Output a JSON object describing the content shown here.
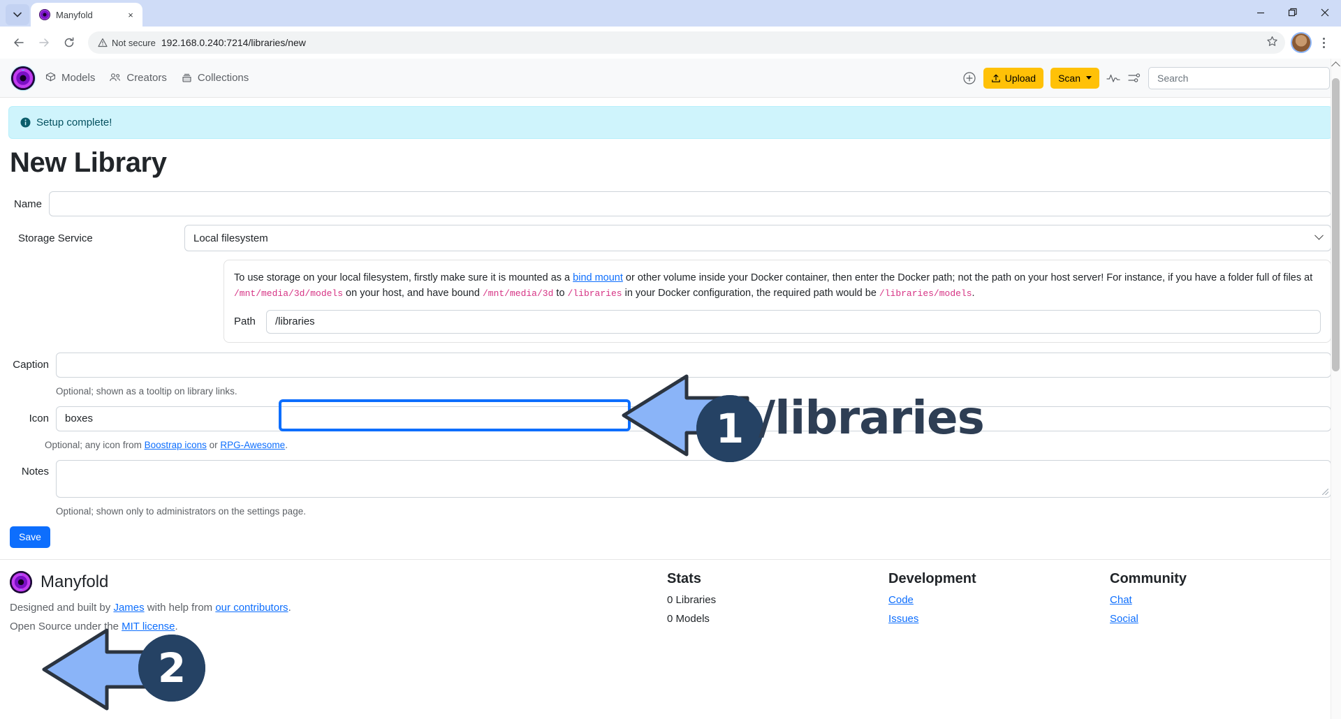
{
  "browser": {
    "tab": {
      "title": "Manyfold",
      "favicon": "manyfold-logo-icon",
      "close": "×"
    },
    "tab_list_icon": "chevron-down-icon",
    "window": {
      "minimize": "–",
      "maximize": "❐",
      "close": "✕"
    },
    "nav": {
      "back": "←",
      "forward": "→",
      "reload": "⟳"
    },
    "security_label": "Not secure",
    "url": "192.168.0.240:7214/libraries/new",
    "bookmark_icon": "star-icon",
    "profile_icon": "profile-avatar",
    "menu_icon": "kebab-menu-icon"
  },
  "sitenav": {
    "brand": "manyfold-logo",
    "links": [
      {
        "label": "Models",
        "icon": "cube-icon"
      },
      {
        "label": "Creators",
        "icon": "people-icon"
      },
      {
        "label": "Collections",
        "icon": "collection-icon"
      }
    ],
    "add_icon": "plus-circle-icon",
    "upload_label": "Upload",
    "upload_icon": "upload-icon",
    "scan_label": "Scan",
    "scan_caret": "caret-down-icon",
    "activity_icon": "activity-pulse-icon",
    "settings_icon": "sliders-icon",
    "search_placeholder": "Search"
  },
  "alert": {
    "icon": "info-circle-icon",
    "text": "Setup complete!"
  },
  "page": {
    "title": "New Library"
  },
  "form": {
    "name": {
      "label": "Name",
      "value": "",
      "placeholder": ""
    },
    "storage_service": {
      "label": "Storage Service",
      "value": "Local filesystem",
      "chevron": "chevron-down-icon"
    },
    "help": {
      "part1": "To use storage on your local filesystem, firstly make sure it is mounted as a ",
      "link1": "bind mount",
      "part2": " or other volume inside your Docker container, then enter the Docker path; not the path on your host server! For instance, if you have a folder full of files at ",
      "code1": "/mnt/media/3d/models",
      "part3": " on your host, and have bound ",
      "code2": "/mnt/media/3d",
      "part4": " to ",
      "code3": "/libraries",
      "part5": " in your Docker configuration, the required path would be ",
      "code4": "/libraries/models",
      "part6": "."
    },
    "path": {
      "label": "Path",
      "value": "/libraries"
    },
    "caption": {
      "label": "Caption",
      "value": "",
      "hint": "Optional; shown as a tooltip on library links."
    },
    "icon": {
      "label": "Icon",
      "value": "boxes",
      "hint_prefix": "Optional; any icon from ",
      "link1": "Boostrap icons",
      "hint_mid": " or ",
      "link2": "RPG-Awesome",
      "hint_suffix": "."
    },
    "notes": {
      "label": "Notes",
      "value": "",
      "hint": "Optional; shown only to administrators on the settings page."
    },
    "save_label": "Save"
  },
  "footer": {
    "brand_name": "Manyfold",
    "line1_prefix": "Designed and built by ",
    "line1_link1": "James",
    "line1_mid": " with help from ",
    "line1_link2": "our contributors",
    "line1_suffix": ".",
    "line2_prefix": "Open Source under the ",
    "line2_link": "MIT license",
    "line2_suffix": ".",
    "columns": [
      {
        "heading": "Stats",
        "items": [
          "0 Libraries",
          "0 Models"
        ],
        "links": false
      },
      {
        "heading": "Development",
        "items": [
          "Code",
          "Issues"
        ],
        "links": true
      },
      {
        "heading": "Community",
        "items": [
          "Chat",
          "Social"
        ],
        "links": true
      }
    ]
  },
  "annotations": {
    "accent_badge": "#254264",
    "accent_arrow": "#8ab4f8",
    "accent_highlight": "#0d6efd",
    "step1": {
      "number": "1",
      "caption": "/libraries"
    },
    "step2": {
      "number": "2"
    }
  }
}
